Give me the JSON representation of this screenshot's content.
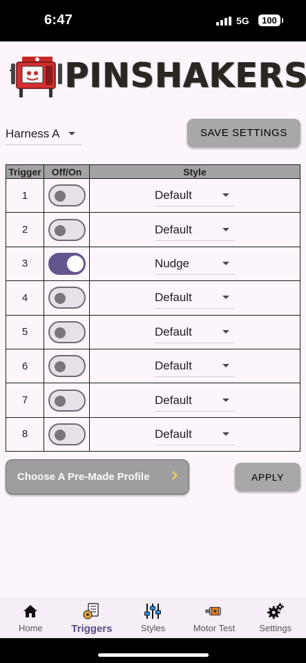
{
  "status_bar": {
    "time": "6:47",
    "network": "5G",
    "battery": "100"
  },
  "logo": {
    "text": "PINSHAKERS"
  },
  "harness": {
    "selected": "Harness A"
  },
  "buttons": {
    "save": "SAVE SETTINGS",
    "apply": "APPLY",
    "profile": "Choose A Pre-Made Profile"
  },
  "table": {
    "headers": [
      "Trigger",
      "Off/On",
      "Style"
    ],
    "rows": [
      {
        "trigger": "1",
        "on": false,
        "style": "Default"
      },
      {
        "trigger": "2",
        "on": false,
        "style": "Default"
      },
      {
        "trigger": "3",
        "on": true,
        "style": "Nudge"
      },
      {
        "trigger": "4",
        "on": false,
        "style": "Default"
      },
      {
        "trigger": "5",
        "on": false,
        "style": "Default"
      },
      {
        "trigger": "6",
        "on": false,
        "style": "Default"
      },
      {
        "trigger": "7",
        "on": false,
        "style": "Default"
      },
      {
        "trigger": "8",
        "on": false,
        "style": "Default"
      }
    ]
  },
  "nav": {
    "items": [
      {
        "label": "Home",
        "icon": "home-icon"
      },
      {
        "label": "Triggers",
        "icon": "triggers-icon",
        "active": true
      },
      {
        "label": "Styles",
        "icon": "sliders-icon"
      },
      {
        "label": "Motor Test",
        "icon": "motor-icon"
      },
      {
        "label": "Settings",
        "icon": "gears-icon"
      }
    ]
  },
  "colors": {
    "accent": "#65558f",
    "background": "#fcf6fc",
    "header_gray": "#a3a3a3",
    "chevron": "#f5d94a"
  }
}
